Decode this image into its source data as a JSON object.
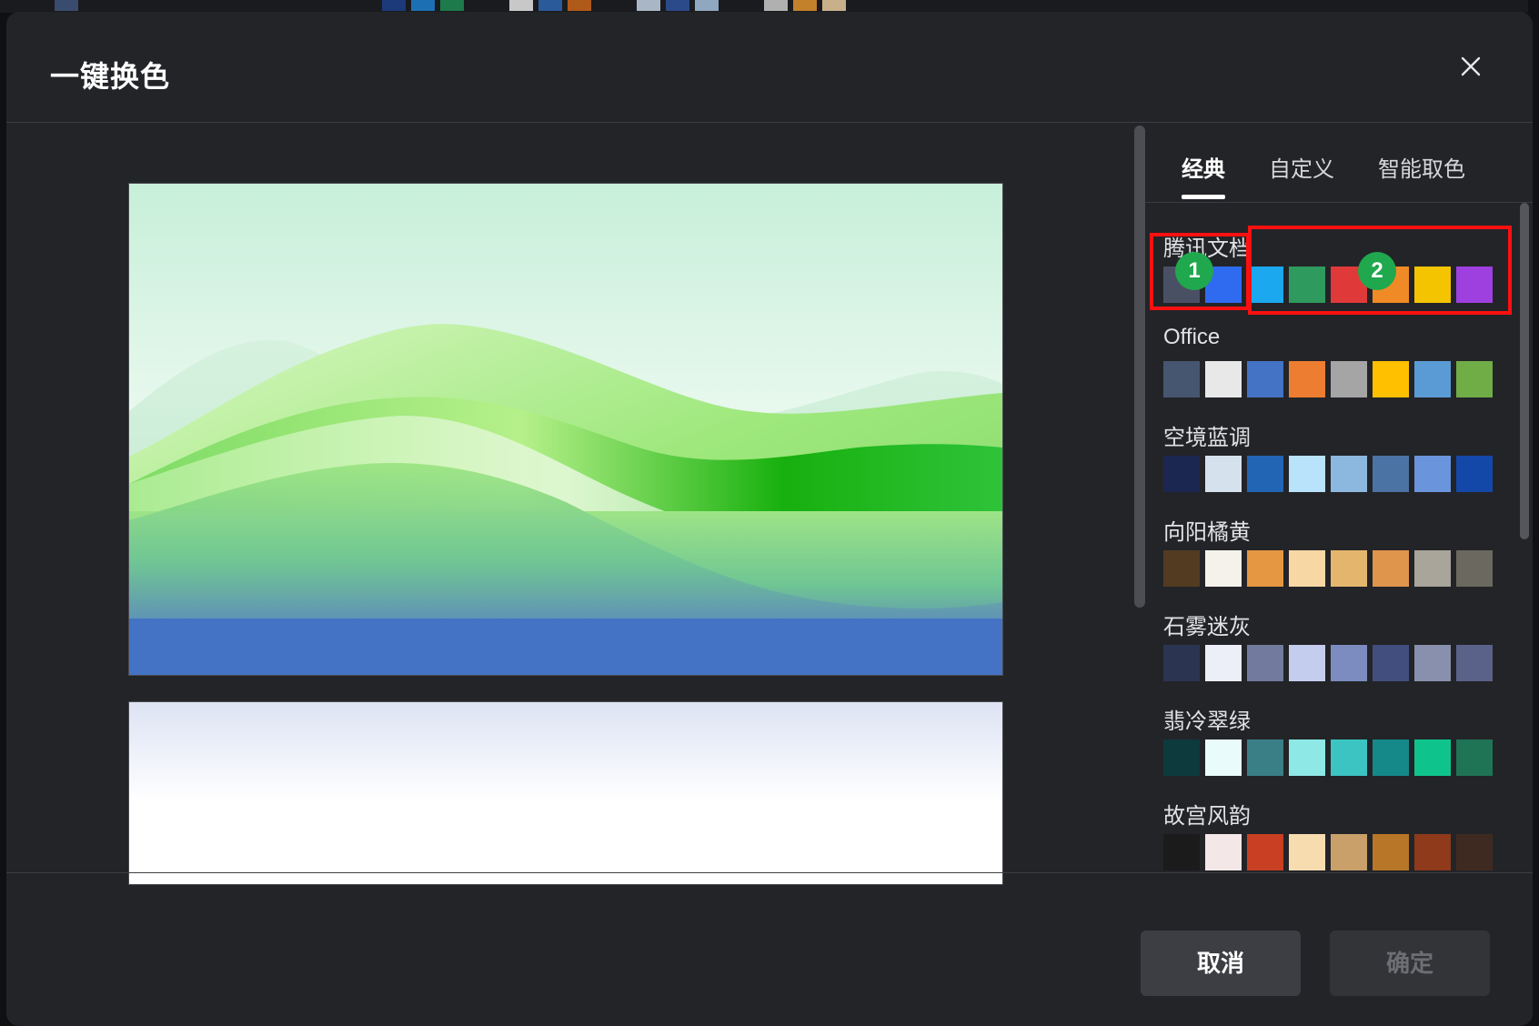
{
  "dialog": {
    "title": "一键换色",
    "close_icon": "close-icon"
  },
  "tabs": [
    {
      "label": "经典",
      "active": true
    },
    {
      "label": "自定义",
      "active": false
    },
    {
      "label": "智能取色",
      "active": false
    }
  ],
  "palettes": [
    {
      "name": "腾讯文档",
      "colors": [
        "#4a5064",
        "#2f6bf0",
        "#1ba8ef",
        "#2f9a5e",
        "#e0393a",
        "#f08a26",
        "#f5c400",
        "#9e3fe0"
      ]
    },
    {
      "name": "Office",
      "colors": [
        "#465670",
        "#e8e8e8",
        "#4472c4",
        "#ed7d31",
        "#a5a5a5",
        "#ffc000",
        "#5b9bd5",
        "#70ad47"
      ]
    },
    {
      "name": "空境蓝调",
      "colors": [
        "#1b2750",
        "#d5e2ee",
        "#2265b5",
        "#b9e2fb",
        "#8cb8e0",
        "#4b73a3",
        "#6a95dc",
        "#1448a8"
      ]
    },
    {
      "name": "向阳橘黄",
      "colors": [
        "#523b20",
        "#f5f1eb",
        "#e59741",
        "#f7d7a4",
        "#e4b66d",
        "#e0954c",
        "#a9a59a",
        "#6b685f"
      ]
    },
    {
      "name": "石雾迷灰",
      "colors": [
        "#2b3552",
        "#eceef8",
        "#727b9d",
        "#c5cdee",
        "#7c8cc0",
        "#424e7e",
        "#8990ad",
        "#5b6289"
      ]
    },
    {
      "name": "翡冷翠绿",
      "colors": [
        "#0c3a3d",
        "#e9fbfb",
        "#3a7f86",
        "#8ee8e6",
        "#3bc4c2",
        "#15898a",
        "#0fc48c",
        "#1f7456"
      ]
    },
    {
      "name": "故宫风韵",
      "colors": [
        "#1b1b1c",
        "#f3e8e7",
        "#c93f23",
        "#f7dcb0",
        "#c9a06a",
        "#b87628",
        "#8e3a1b",
        "#3f2a21"
      ]
    }
  ],
  "annotations": [
    {
      "badge": "1"
    },
    {
      "badge": "2"
    }
  ],
  "buttons": {
    "cancel": "取消",
    "confirm": "确定"
  }
}
